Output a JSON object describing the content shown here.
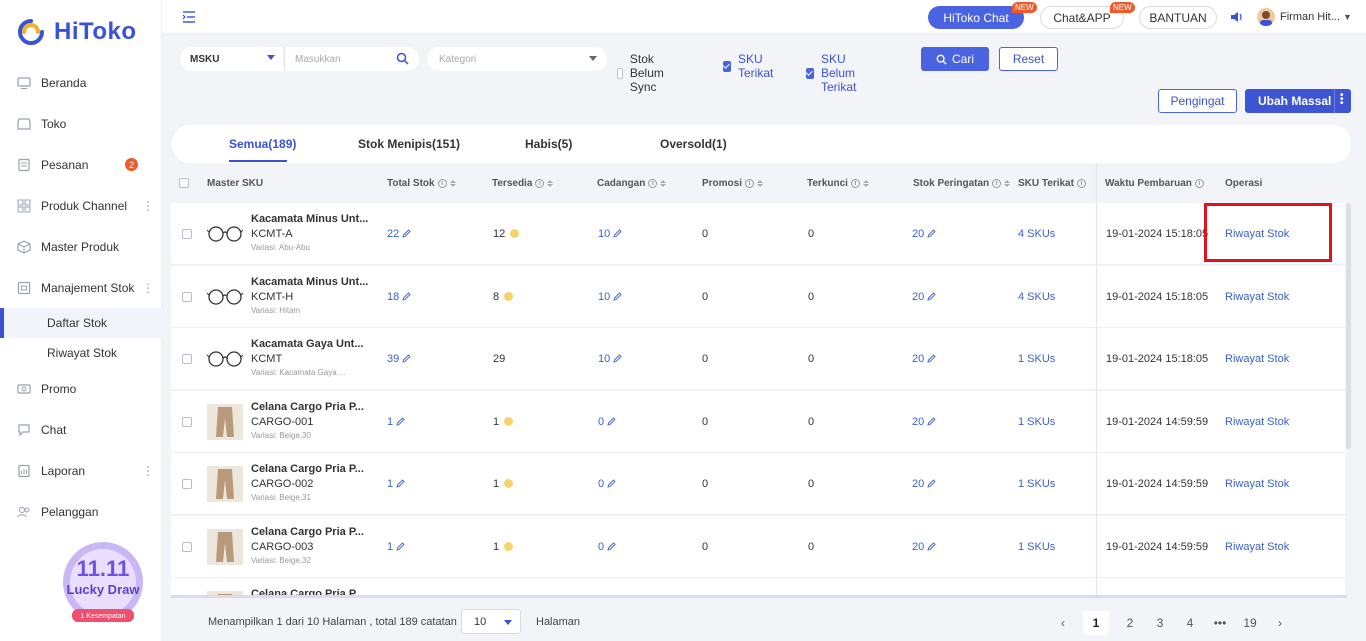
{
  "brand": {
    "name": "HiToko"
  },
  "sidebar": {
    "items": [
      {
        "label": "Beranda",
        "icon": "monitor-icon"
      },
      {
        "label": "Toko",
        "icon": "store-icon"
      },
      {
        "label": "Pesanan",
        "icon": "orders-icon",
        "badge": "2"
      },
      {
        "label": "Produk Channel",
        "icon": "grid-icon"
      },
      {
        "label": "Master Produk",
        "icon": "box-icon"
      },
      {
        "label": "Manajement Stok",
        "icon": "warehouse-icon"
      }
    ],
    "sub_items": [
      {
        "label": "Daftar Stok",
        "active": true
      },
      {
        "label": "Riwayat Stok",
        "active": false
      }
    ],
    "items_after": [
      {
        "label": "Promo",
        "icon": "promo-icon"
      },
      {
        "label": "Chat",
        "icon": "chat-icon"
      },
      {
        "label": "Laporan",
        "icon": "report-icon"
      },
      {
        "label": "Pelanggan",
        "icon": "users-icon"
      }
    ],
    "promo": {
      "line1": "11.11",
      "line2": "Lucky Draw",
      "ribbon": "1 Kesempatan"
    }
  },
  "topbar": {
    "hitoko_chat": "HiToko Chat",
    "chat_app": "Chat&APP",
    "bantuan": "BANTUAN",
    "new_tag": "NEW",
    "user_name": "Firman Hit..."
  },
  "filters": {
    "field_select": "MSKU",
    "search_placeholder": "Masukkan",
    "category_placeholder": "Kategori",
    "checkboxes": [
      {
        "label": "Stok Belum Sync",
        "checked": false
      },
      {
        "label": "SKU Terikat",
        "checked": true
      },
      {
        "label": "SKU Belum Terikat",
        "checked": true
      }
    ],
    "search_button": "Cari",
    "reset_button": "Reset"
  },
  "actions": {
    "pengingat": "Pengingat",
    "ubah_massal": "Ubah Massal"
  },
  "tabs": [
    {
      "label": "Semua(189)",
      "active": true
    },
    {
      "label": "Stok Menipis(151)",
      "active": false
    },
    {
      "label": "Habis(5)",
      "active": false
    },
    {
      "label": "Oversold(1)",
      "active": false
    }
  ],
  "table": {
    "headers": {
      "master_sku": "Master SKU",
      "total_stok": "Total Stok",
      "tersedia": "Tersedia",
      "cadangan": "Cadangan",
      "promosi": "Promosi",
      "terkunci": "Terkunci",
      "stok_peringatan": "Stok Peringatan",
      "sku_terikat": "SKU Terikat",
      "waktu": "Waktu Pembaruan",
      "operasi": "Operasi"
    },
    "rows": [
      {
        "name": "Kacamata Minus Unt...",
        "sku": "KCMT-A",
        "variant": "Variasi: Abu-Abu",
        "thumb": "glasses",
        "total": "22",
        "tersedia": "12",
        "coin": true,
        "cadangan": "10",
        "promosi": "0",
        "terkunci": "0",
        "peringatan": "20",
        "sku_terikat": "4 SKUs",
        "waktu": "19-01-2024 15:18:05",
        "operasi": "Riwayat Stok"
      },
      {
        "name": "Kacamata Minus Unt...",
        "sku": "KCMT-H",
        "variant": "Variasi: Hitam",
        "thumb": "glasses",
        "total": "18",
        "tersedia": "8",
        "coin": true,
        "cadangan": "10",
        "promosi": "0",
        "terkunci": "0",
        "peringatan": "20",
        "sku_terikat": "4 SKUs",
        "waktu": "19-01-2024 15:18:05",
        "operasi": "Riwayat Stok"
      },
      {
        "name": "Kacamata Gaya Unt...",
        "sku": "KCMT",
        "variant": "Variasi: Kacamata Gaya ...",
        "thumb": "glasses",
        "total": "39",
        "tersedia": "29",
        "coin": false,
        "cadangan": "10",
        "promosi": "0",
        "terkunci": "0",
        "peringatan": "20",
        "sku_terikat": "1 SKUs",
        "waktu": "19-01-2024 15:18:05",
        "operasi": "Riwayat Stok"
      },
      {
        "name": "Celana Cargo Pria P...",
        "sku": "CARGO-001",
        "variant": "Variasi: Beige,30",
        "thumb": "pants",
        "total": "1",
        "tersedia": "1",
        "coin": true,
        "cadangan": "0",
        "promosi": "0",
        "terkunci": "0",
        "peringatan": "20",
        "sku_terikat": "1 SKUs",
        "waktu": "19-01-2024 14:59:59",
        "operasi": "Riwayat Stok"
      },
      {
        "name": "Celana Cargo Pria P...",
        "sku": "CARGO-002",
        "variant": "Variasi: Beige,31",
        "thumb": "pants",
        "total": "1",
        "tersedia": "1",
        "coin": true,
        "cadangan": "0",
        "promosi": "0",
        "terkunci": "0",
        "peringatan": "20",
        "sku_terikat": "1 SKUs",
        "waktu": "19-01-2024 14:59:59",
        "operasi": "Riwayat Stok"
      },
      {
        "name": "Celana Cargo Pria P...",
        "sku": "CARGO-003",
        "variant": "Variasi: Beige,32",
        "thumb": "pants",
        "total": "1",
        "tersedia": "1",
        "coin": true,
        "cadangan": "0",
        "promosi": "0",
        "terkunci": "0",
        "peringatan": "20",
        "sku_terikat": "1 SKUs",
        "waktu": "19-01-2024 14:59:59",
        "operasi": "Riwayat Stok"
      },
      {
        "name": "Celana Cargo Pria P...",
        "sku": "",
        "variant": "",
        "thumb": "pants",
        "total": "",
        "tersedia": "",
        "coin": false,
        "cadangan": "",
        "promosi": "",
        "terkunci": "",
        "peringatan": "",
        "sku_terikat": "",
        "waktu": "",
        "operasi": ""
      }
    ]
  },
  "footer": {
    "summary": "Menampilkan 1 dari 10 Halaman , total 189 catatan",
    "page_size": "10",
    "halaman": "Halaman",
    "pages": [
      "1",
      "2",
      "3",
      "4",
      "•••",
      "19"
    ],
    "current_page": "1"
  }
}
